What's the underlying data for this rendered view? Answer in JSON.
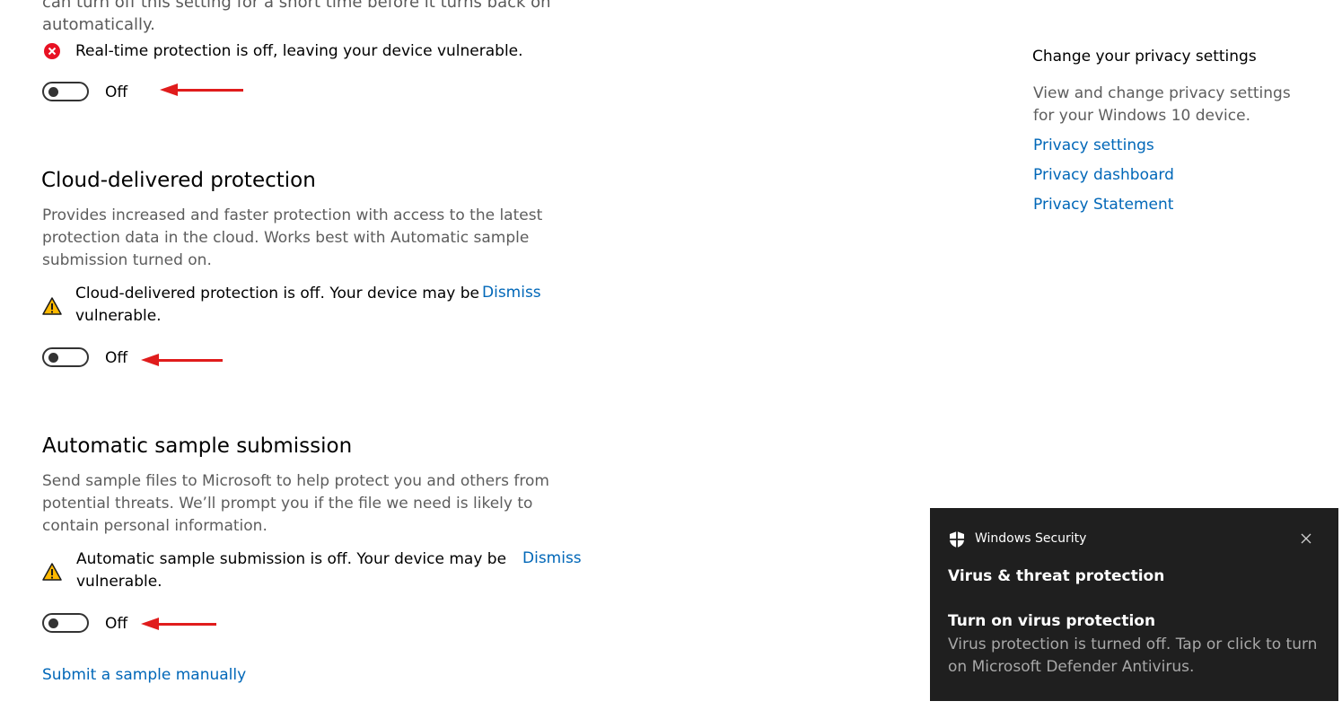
{
  "realtime": {
    "cut_text_line1": "can turn off this setting for a short time before it turns back on",
    "cut_text_line2": "automatically.",
    "alert": "Real-time protection is off, leaving your device vulnerable.",
    "toggle_label": "Off"
  },
  "cloud": {
    "title": "Cloud-delivered protection",
    "desc": "Provides increased and faster protection with access to the latest protection data in the cloud. Works best with Automatic sample submission turned on.",
    "warn_line1": "Cloud-delivered protection is off. Your device may be",
    "warn_line2": "vulnerable.",
    "dismiss": "Dismiss",
    "toggle_label": "Off"
  },
  "sample": {
    "title": "Automatic sample submission",
    "desc": "Send sample files to Microsoft to help protect you and others from potential threats. We’ll prompt you if the file we need is likely to contain personal information.",
    "warn_line1": "Automatic sample submission is off. Your device may be",
    "warn_line2": "vulnerable.",
    "dismiss": "Dismiss",
    "toggle_label": "Off",
    "submit_link": "Submit a sample manually"
  },
  "privacy": {
    "title": "Change your privacy settings",
    "desc": "View and change privacy settings for your Windows 10 device.",
    "links": [
      "Privacy settings",
      "Privacy dashboard",
      "Privacy Statement"
    ]
  },
  "toast": {
    "app_name": "Windows Security",
    "title": "Virus & threat protection",
    "heading": "Turn on virus protection",
    "body": "Virus protection is turned off. Tap or click to turn on Microsoft Defender Antivirus."
  },
  "colors": {
    "link": "#0067b8",
    "error": "#e81123",
    "warning": "#ffb900",
    "annotation_arrow": "#e01c1c",
    "toast_bg": "#1f1f1f"
  }
}
